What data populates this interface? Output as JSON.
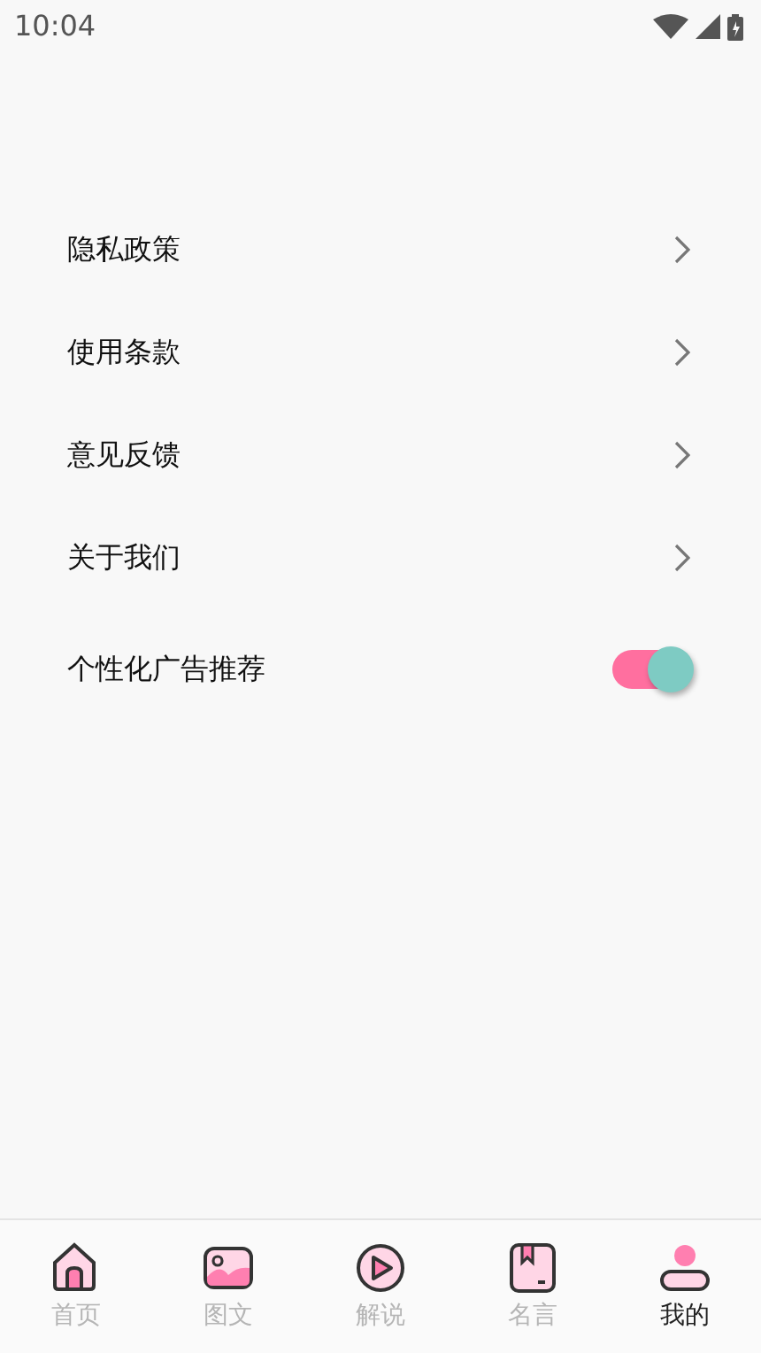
{
  "status_bar": {
    "time": "10:04"
  },
  "menu": [
    {
      "kind": "link",
      "label": "隐私政策"
    },
    {
      "kind": "link",
      "label": "使用条款"
    },
    {
      "kind": "link",
      "label": "意见反馈"
    },
    {
      "kind": "link",
      "label": "关于我们"
    },
    {
      "kind": "toggle",
      "label": "个性化广告推荐",
      "on": true
    }
  ],
  "bottom_nav": [
    {
      "kind": "home",
      "label": "首页",
      "selected": false
    },
    {
      "kind": "image",
      "label": "图文",
      "selected": false
    },
    {
      "kind": "play",
      "label": "解说",
      "selected": false
    },
    {
      "kind": "book",
      "label": "名言",
      "selected": false
    },
    {
      "kind": "person",
      "label": "我的",
      "selected": true
    }
  ]
}
